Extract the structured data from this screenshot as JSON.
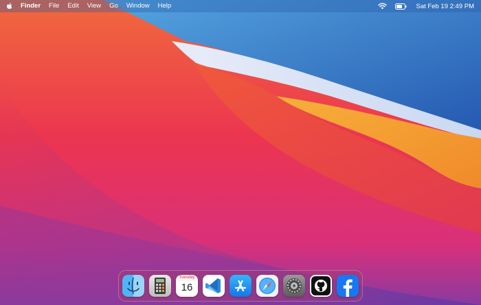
{
  "menubar": {
    "apple_icon": "apple-logo-icon",
    "app_name": "Finder",
    "menus": [
      "File",
      "Edit",
      "View",
      "Go",
      "Window",
      "Help"
    ],
    "status_icons": [
      "wifi-icon",
      "battery-icon"
    ],
    "clock": "Sat Feb 19  2:49 PM"
  },
  "dock": {
    "apps": [
      {
        "name": "Finder",
        "icon": "finder-icon"
      },
      {
        "name": "Calculator",
        "icon": "calculator-icon"
      },
      {
        "name": "Calendar",
        "icon": "calendar-icon",
        "weekday": "Tuesday",
        "day": "16"
      },
      {
        "name": "Visual Studio Code",
        "icon": "vscode-icon"
      },
      {
        "name": "App Store",
        "icon": "app-store-icon"
      },
      {
        "name": "Safari",
        "icon": "safari-icon"
      },
      {
        "name": "System Preferences",
        "icon": "system-preferences-icon"
      },
      {
        "name": "GitHub Desktop",
        "icon": "github-icon"
      },
      {
        "name": "Facebook",
        "icon": "facebook-icon"
      }
    ]
  },
  "colors": {
    "wallpaper_red": "#e8344a",
    "wallpaper_orange": "#f2a33a",
    "wallpaper_blue": "#2f6fc4",
    "wallpaper_purple": "#6a3a9a"
  }
}
